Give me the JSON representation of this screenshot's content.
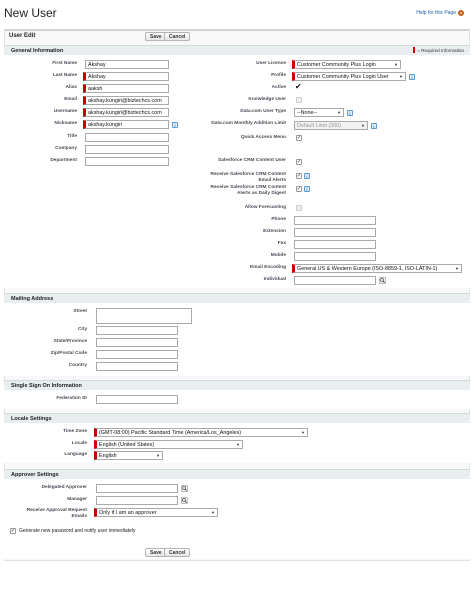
{
  "page": {
    "title": "New User",
    "help_link": "Help for this Page",
    "help_icon": "?"
  },
  "edit": {
    "subtitle": "User Edit",
    "save_label": "Save",
    "cancel_label": "Cancel"
  },
  "required_legend": "= Required Information",
  "general": {
    "header": "General Information",
    "first_name": {
      "label": "First Name",
      "value": "Akshay"
    },
    "last_name": {
      "label": "Last Name",
      "value": "Akshay"
    },
    "alias": {
      "label": "Alias",
      "value": "aaksh"
    },
    "email": {
      "label": "Email",
      "value": "akshay.kungiri@biztechcs.com"
    },
    "username": {
      "label": "Username",
      "value": "akshay.kungiri@biztechcs.com"
    },
    "nickname": {
      "label": "Nickname",
      "value": "akshay.kungiri"
    },
    "title": {
      "label": "Title",
      "value": ""
    },
    "company": {
      "label": "Company",
      "value": ""
    },
    "department": {
      "label": "Department",
      "value": ""
    },
    "user_license": {
      "label": "User License",
      "value": "Customer Community Plus Login"
    },
    "profile": {
      "label": "Profile",
      "value": "Customer Community Plus Login User"
    },
    "active": {
      "label": "Active",
      "checked": true
    },
    "knowledge_user": {
      "label": "Knowledge User",
      "checked": false
    },
    "datacom_user_type": {
      "label": "Data.com User Type",
      "value": "--None--"
    },
    "datacom_limit": {
      "label": "Data.com Monthly Addition Limit",
      "value": "Default Limit (300)"
    },
    "quick_access_menu": {
      "label": "Quick Access Menu",
      "checked": true
    },
    "crm_content_user": {
      "label": "Salesforce CRM Content User",
      "checked": true
    },
    "crm_email_alerts": {
      "label": "Receive Salesforce CRM Content Email Alerts",
      "checked": true
    },
    "crm_daily_digest": {
      "label": "Receive Salesforce CRM Content Alerts as Daily Digest",
      "checked": true
    },
    "allow_forecasting": {
      "label": "Allow Forecasting",
      "checked": false
    },
    "phone": {
      "label": "Phone",
      "value": ""
    },
    "extension": {
      "label": "Extension",
      "value": ""
    },
    "fax": {
      "label": "Fax",
      "value": ""
    },
    "mobile": {
      "label": "Mobile",
      "value": ""
    },
    "email_encoding": {
      "label": "Email Encoding",
      "value": "General US & Western Europe (ISO-8859-1, ISO-LATIN-1)"
    },
    "individual": {
      "label": "Individual",
      "value": ""
    },
    "info_icon": "i"
  },
  "mailing": {
    "header": "Mailing Address",
    "street": {
      "label": "Street",
      "value": ""
    },
    "city": {
      "label": "City",
      "value": ""
    },
    "state": {
      "label": "State/Province",
      "value": ""
    },
    "zip": {
      "label": "Zip/Postal Code",
      "value": ""
    },
    "country": {
      "label": "Country",
      "value": ""
    }
  },
  "sso": {
    "header": "Single Sign On Information",
    "federation_id": {
      "label": "Federation ID",
      "value": ""
    }
  },
  "locale": {
    "header": "Locale Settings",
    "time_zone": {
      "label": "Time Zone",
      "value": "(GMT-08:00) Pacific Standard Time (America/Los_Angeles)"
    },
    "locale": {
      "label": "Locale",
      "value": "English (United States)"
    },
    "language": {
      "label": "Language",
      "value": "English"
    }
  },
  "approver": {
    "header": "Approver Settings",
    "delegated_approver": {
      "label": "Delegated Approver",
      "value": ""
    },
    "manager": {
      "label": "Manager",
      "value": ""
    },
    "receive_emails": {
      "label": "Receive Approval Request Emails",
      "value": "Only if I am an approver"
    }
  },
  "generate_password": {
    "label": "Generate new password and notify user immediately",
    "checked": true
  },
  "colors": {
    "required": "#cc0000",
    "section_header": "#e8edf0",
    "panel_bg": "#f8f8f8",
    "link": "#1b5fa8"
  }
}
